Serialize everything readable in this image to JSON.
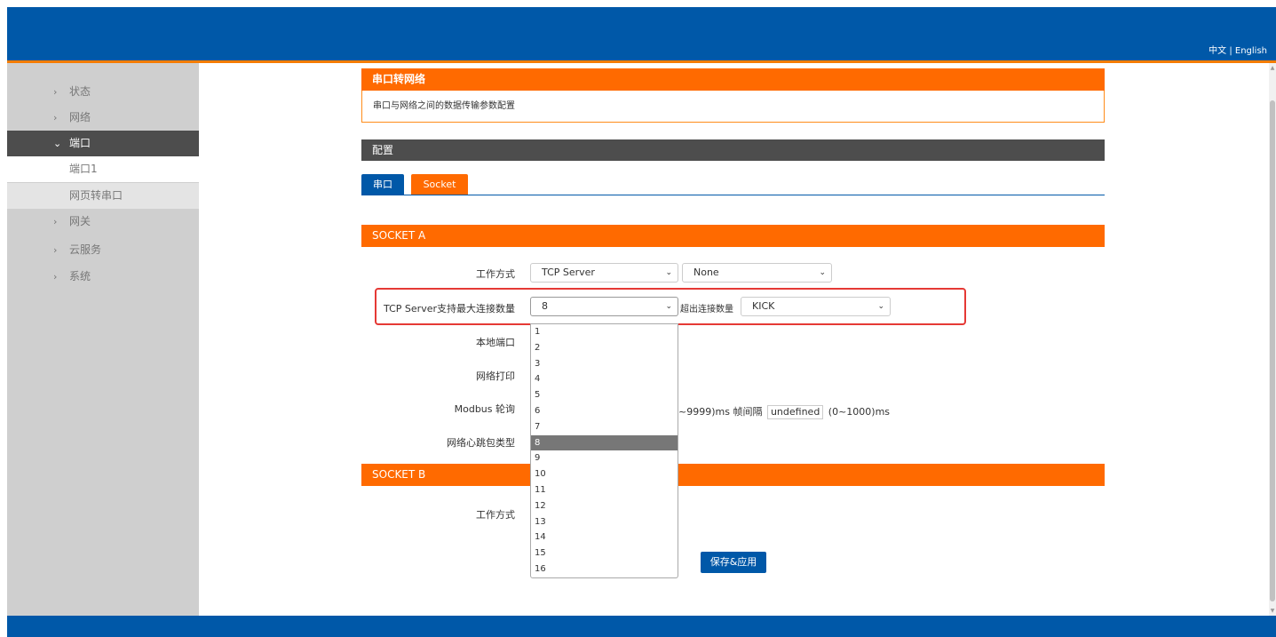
{
  "header": {
    "lang_zh": "中文",
    "lang_sep": " | ",
    "lang_en": "English"
  },
  "sidebar": {
    "items": [
      {
        "label": "状态",
        "state": "collapsed"
      },
      {
        "label": "网络",
        "state": "collapsed"
      },
      {
        "label": "端口",
        "state": "expanded"
      },
      {
        "label": "端口1",
        "state": "current"
      },
      {
        "label": "网页转串口",
        "state": "child"
      },
      {
        "label": "网关",
        "state": "collapsed"
      },
      {
        "label": "云服务",
        "state": "collapsed"
      },
      {
        "label": "系统",
        "state": "collapsed"
      }
    ]
  },
  "page": {
    "title": "串口转网络",
    "description": "串口与网络之间的数据传输参数配置",
    "config_label": "配置",
    "tabs": [
      {
        "label": "串口"
      },
      {
        "label": "Socket"
      }
    ]
  },
  "socket_a": {
    "title": "SOCKET A",
    "work_mode_label": "工作方式",
    "work_mode_value": "TCP Server",
    "work_mode_secondary_value": "None",
    "max_conn_label": "TCP Server支持最大连接数量",
    "max_conn_value": "8",
    "overflow_label": "超出连接数量",
    "overflow_value": "KICK",
    "local_port_label": "本地端口",
    "net_print_label": "网络打印",
    "modbus_label": "Modbus 轮询",
    "modbus_suffix": "~9999)ms 帧间隔",
    "frame_interval_value": "undefined",
    "frame_interval_range": "(0~1000)ms",
    "heartbeat_label": "网络心跳包类型"
  },
  "dropdown": {
    "options": [
      "1",
      "2",
      "3",
      "4",
      "5",
      "6",
      "7",
      "8",
      "9",
      "10",
      "11",
      "12",
      "13",
      "14",
      "15",
      "16"
    ],
    "selected": "8"
  },
  "socket_b": {
    "title": "SOCKET B",
    "work_mode_label": "工作方式"
  },
  "actions": {
    "save_label": "保存&应用"
  },
  "colors": {
    "brand_blue": "#0058a8",
    "accent_orange": "#ff6a00",
    "dark_bar": "#4d4d4d",
    "highlight_red": "#e53935"
  }
}
